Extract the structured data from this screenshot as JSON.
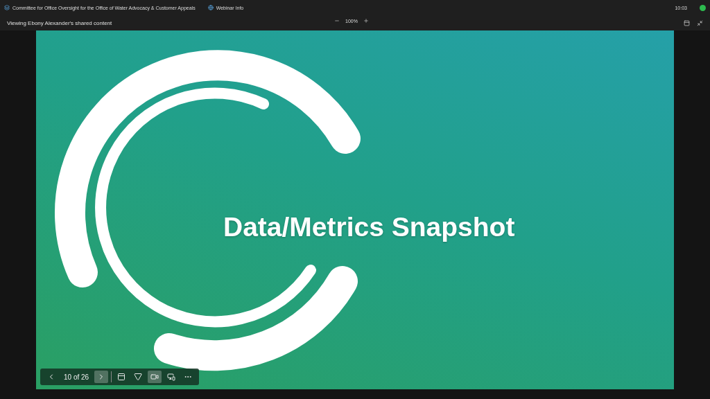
{
  "tabs": [
    {
      "label": "Committee for Office Oversight for the Office of Water Advocacy & Customer Appeals",
      "kind": "meeting"
    },
    {
      "label": "Webinar Info",
      "kind": "info"
    }
  ],
  "clock": "10:03",
  "share_bar": {
    "viewing": "Viewing Ebony Alexander's shared content",
    "zoom": "100%"
  },
  "slide": {
    "title": "Data/Metrics Snapshot"
  },
  "slide_toolbar": {
    "counter": "10 of 26",
    "tools": [
      {
        "kind": "notes",
        "selected": false
      },
      {
        "kind": "laser",
        "selected": false
      },
      {
        "kind": "camera",
        "selected": true
      },
      {
        "kind": "chat",
        "selected": false
      },
      {
        "kind": "more",
        "selected": false
      }
    ]
  }
}
